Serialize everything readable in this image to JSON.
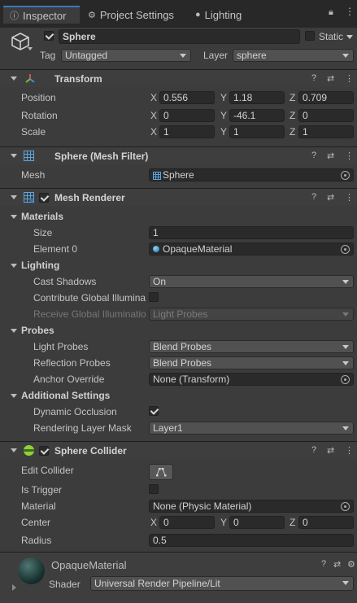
{
  "tabs": {
    "inspector": "Inspector",
    "project_settings": "Project Settings",
    "lighting": "Lighting"
  },
  "object": {
    "name": "Sphere",
    "static_label": "Static",
    "tag_label": "Tag",
    "tag_value": "Untagged",
    "layer_label": "Layer",
    "layer_value": "sphere"
  },
  "transform": {
    "title": "Transform",
    "position_label": "Position",
    "rotation_label": "Rotation",
    "scale_label": "Scale",
    "x": "X",
    "y": "Y",
    "z": "Z",
    "position": {
      "x": "0.556",
      "y": "1.18",
      "z": "0.709"
    },
    "rotation": {
      "x": "0",
      "y": "-46.1",
      "z": "0"
    },
    "scale": {
      "x": "1",
      "y": "1",
      "z": "1"
    }
  },
  "mesh_filter": {
    "title": "Sphere (Mesh Filter)",
    "mesh_label": "Mesh",
    "mesh_value": "Sphere"
  },
  "mesh_renderer": {
    "title": "Mesh Renderer",
    "materials_label": "Materials",
    "size_label": "Size",
    "size_value": "1",
    "element0_label": "Element 0",
    "element0_value": "OpaqueMaterial",
    "lighting_label": "Lighting",
    "cast_shadows_label": "Cast Shadows",
    "cast_shadows_value": "On",
    "contribute_gi_label": "Contribute Global Illumina",
    "receive_gi_label": "Receive Global Illuminatio",
    "receive_gi_value": "Light Probes",
    "probes_label": "Probes",
    "light_probes_label": "Light Probes",
    "light_probes_value": "Blend Probes",
    "reflection_probes_label": "Reflection Probes",
    "reflection_probes_value": "Blend Probes",
    "anchor_override_label": "Anchor Override",
    "anchor_override_value": "None (Transform)",
    "additional_label": "Additional Settings",
    "dynamic_occlusion_label": "Dynamic Occlusion",
    "rendering_layer_mask_label": "Rendering Layer Mask",
    "rendering_layer_mask_value": "Layer1"
  },
  "sphere_collider": {
    "title": "Sphere Collider",
    "edit_collider_label": "Edit Collider",
    "is_trigger_label": "Is Trigger",
    "material_label": "Material",
    "material_value": "None (Physic Material)",
    "center_label": "Center",
    "center": {
      "x": "0",
      "y": "0",
      "z": "0"
    },
    "radius_label": "Radius",
    "radius_value": "0.5"
  },
  "material_preview": {
    "name": "OpaqueMaterial",
    "shader_label": "Shader",
    "shader_value": "Universal Render Pipeline/Lit"
  },
  "colors": {
    "accent": "#3a79bb",
    "bg": "#3c3c3c",
    "field": "#2a2a2a"
  }
}
